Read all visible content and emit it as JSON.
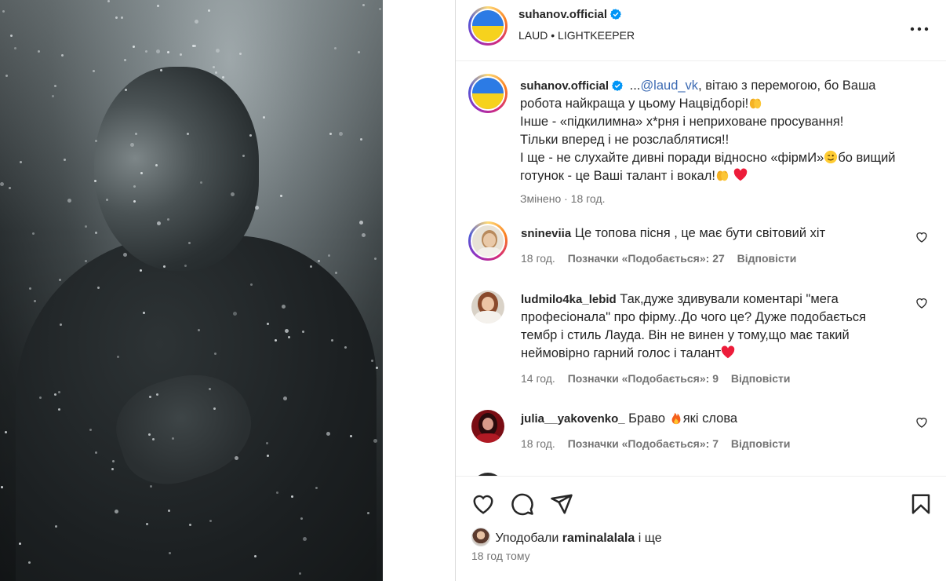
{
  "post": {
    "username": "suhanov.official",
    "subtitle_artist": "LAUD",
    "subtitle_sep": "•",
    "subtitle_track": "LIGHTKEEPER"
  },
  "caption": {
    "username": "suhanov.official",
    "prefix": "...",
    "mention": "@laud_vk",
    "text_1": ", вітаю з перемогою, бо Ваша робота найкраща у цьому Нацвідборі!",
    "line_2": "Інше - «підкилимна» х*рня і неприховане просування!",
    "line_3": "Тільки вперед і не розслаблятися!!",
    "line_4a": "І ще - не слухайте дивні поради відносно «фірмИ»",
    "line_4b": "бо вищий готунок - це Ваші талант і вокал!",
    "meta": "Змінено · 18 год."
  },
  "comments": [
    {
      "username": "snineviia",
      "text": "Це топова пісня , це має бути світовий хіт",
      "time": "18 год.",
      "likes": "Позначки «Подобається»: 27",
      "reply": "Відповісти"
    },
    {
      "username": "ludmilo4ka_lebid",
      "text": "Так,дуже здивували коментарі \"мега професіонала\" про фірму..До чого це? Дуже подобається тембр і стиль Лауда. Він не винен у тому,що має такий неймовірно гарний голос і талант",
      "time": "14 год.",
      "likes": "Позначки «Подобається»: 9",
      "reply": "Відповісти"
    },
    {
      "username": "julia__yakovenko_",
      "text_a": "Браво ",
      "text_b": "які слова",
      "time": "18 год.",
      "likes": "Позначки «Подобається»: 7",
      "reply": "Відповісти"
    }
  ],
  "footer": {
    "liked_prefix": "Уподобали ",
    "liked_user": "raminalalala",
    "liked_suffix": " і ще",
    "time_ago": "18 год тому"
  },
  "colors": {
    "link": "#3d6bb3",
    "muted": "#737373",
    "verified": "#0095f6",
    "heart": "#ed1c3a"
  },
  "icons": [
    "more-icon",
    "verified-icon",
    "heart-icon",
    "comment-icon",
    "share-icon",
    "bookmark-icon",
    "clap-emoji",
    "red-heart-emoji",
    "wink-emoji",
    "fire-emoji"
  ]
}
